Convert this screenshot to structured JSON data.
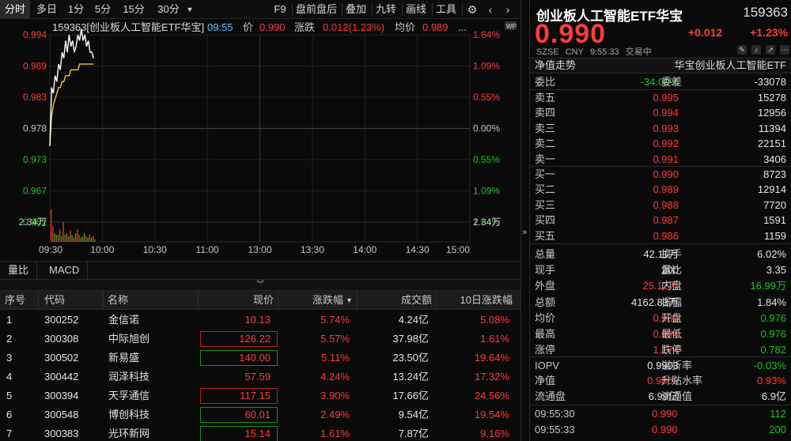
{
  "toolbar": {
    "periods": [
      "分时",
      "多日",
      "1分",
      "5分",
      "15分",
      "30分"
    ],
    "dropdown_icon": "caret-down-icon",
    "tools": [
      "F9",
      "盘前盘后",
      "叠加",
      "九转",
      "画线",
      "工具"
    ],
    "icons": [
      "gear-icon",
      "chevron-left-icon",
      "chevron-right-icon"
    ]
  },
  "chart_header": {
    "code_name": "159363[创业板人工智能ETF华宝]",
    "time": "09:55",
    "price_label": "价",
    "price": "0.990",
    "change_label": "涨跌",
    "change": "0.012(1.23%)",
    "avg_label": "均价",
    "avg": "0.989",
    "more": "...",
    "wp_badge": "WP"
  },
  "chart_data": {
    "type": "line",
    "x_ticks": [
      "09:30",
      "10:00",
      "10:30",
      "11:00",
      "13:00",
      "13:30",
      "14:00",
      "14:30",
      "15:00"
    ],
    "price_ticks": [
      "0.994",
      "0.989",
      "0.983",
      "0.978",
      "0.973",
      "0.967",
      "0.962"
    ],
    "pct_ticks": [
      "1.64%",
      "1.09%",
      "0.55%",
      "0.00%",
      "0.55%",
      "1.09%",
      "1.64%"
    ],
    "prev_close": 0.978,
    "ylim": [
      0.962,
      0.994
    ],
    "volume_label": "2.34万",
    "series": [
      {
        "x": [
          0,
          1,
          2,
          3,
          4,
          5,
          6,
          7,
          8,
          9,
          10,
          11,
          12,
          13,
          14,
          15,
          16,
          17,
          18,
          19,
          20,
          21,
          22,
          23,
          24,
          25
        ],
        "values": [
          0.975,
          0.985,
          0.984,
          0.987,
          0.986,
          0.989,
          0.988,
          0.991,
          0.99,
          0.993,
          0.991,
          0.994,
          0.992,
          0.993,
          0.991,
          0.992,
          0.994,
          0.993,
          0.995,
          0.993,
          0.994,
          0.992,
          0.993,
          0.991,
          0.991,
          0.99
        ]
      },
      {
        "x": [
          0,
          1,
          2,
          3,
          4,
          5,
          6,
          7,
          8,
          9,
          10,
          11,
          12,
          13,
          14,
          15,
          16,
          17,
          18,
          19,
          20,
          21,
          22,
          23,
          24,
          25
        ],
        "values": [
          0.975,
          0.98,
          0.982,
          0.983,
          0.984,
          0.985,
          0.985,
          0.986,
          0.986,
          0.987,
          0.987,
          0.987,
          0.988,
          0.988,
          0.988,
          0.988,
          0.988,
          0.989,
          0.989,
          0.989,
          0.989,
          0.989,
          0.989,
          0.989,
          0.989,
          0.989
        ]
      }
    ],
    "volumes": [
      2.3,
      1.1,
      0.6,
      0.5,
      0.5,
      0.9,
      0.4,
      1.4,
      0.5,
      0.6,
      0.4,
      0.8,
      0.5,
      0.3,
      0.6,
      0.9,
      0.5,
      0.3,
      0.4,
      0.6,
      0.4,
      0.3,
      0.5,
      0.3,
      0.4,
      0.2
    ],
    "volume_colors": [
      "red",
      "red",
      "green",
      "red",
      "green",
      "red",
      "green",
      "red",
      "green",
      "red",
      "green",
      "red",
      "green",
      "red",
      "green",
      "red",
      "red",
      "green",
      "red",
      "green",
      "red",
      "green",
      "red",
      "green",
      "red",
      "green"
    ],
    "volume_max": 2.34,
    "total_minutes": 240,
    "colors": {
      "price_line": "#ffffff",
      "avg_line": "#e8c547",
      "grid": "#262626",
      "up": "#ff3b3b",
      "down": "#19c819"
    }
  },
  "subtabs": [
    "量比",
    "MACD"
  ],
  "collapse_icon": "double-chevron-down-icon",
  "table": {
    "headers": [
      "序号",
      "代码",
      "名称",
      "现价",
      "涨跌幅",
      "成交额",
      "10日涨跌幅"
    ],
    "sort_icon": "caret-down-icon",
    "rows": [
      {
        "no": "1",
        "code": "300252",
        "name": "金信诺",
        "price": "10.13",
        "pct": "5.74%",
        "amount": "4.24亿",
        "pct10": "5.08%",
        "box": ""
      },
      {
        "no": "2",
        "code": "300308",
        "name": "中际旭创",
        "price": "126.22",
        "pct": "5.57%",
        "amount": "37.98亿",
        "pct10": "1.61%",
        "box": "red"
      },
      {
        "no": "3",
        "code": "300502",
        "name": "新易盛",
        "price": "140.00",
        "pct": "5.11%",
        "amount": "23.50亿",
        "pct10": "19.64%",
        "box": "green"
      },
      {
        "no": "4",
        "code": "300442",
        "name": "润泽科技",
        "price": "57.59",
        "pct": "4.24%",
        "amount": "13.24亿",
        "pct10": "17.32%",
        "box": ""
      },
      {
        "no": "5",
        "code": "300394",
        "name": "天孚通信",
        "price": "117.15",
        "pct": "3.90%",
        "amount": "17.66亿",
        "pct10": "24.56%",
        "box": "red"
      },
      {
        "no": "6",
        "code": "300548",
        "name": "博创科技",
        "price": "60.01",
        "pct": "2.49%",
        "amount": "9.54亿",
        "pct10": "19.54%",
        "box": "green"
      },
      {
        "no": "7",
        "code": "300383",
        "name": "光环新网",
        "price": "15.14",
        "pct": "1.61%",
        "amount": "7.87亿",
        "pct10": "9.16%",
        "box": "green"
      }
    ]
  },
  "divider_icon": "double-chevron-right-icon",
  "quote": {
    "name": "创业板人工智能ETF华宝",
    "code": "159363",
    "price": "0.990",
    "change": "+0.012",
    "pct": "+1.23%",
    "exchange": "SZSE",
    "currency": "CNY",
    "time": "9:55:33",
    "status": "交易中",
    "icons": [
      "edit-icon",
      "bell-icon",
      "share-icon",
      "more-icon"
    ],
    "nav_label": "净值走势",
    "nav_name": "华宝创业板人工智能ETF",
    "weibi": {
      "label": "委比",
      "value": "-34.00%",
      "label2": "委差",
      "value2": "-33078"
    },
    "asks": [
      {
        "label": "卖五",
        "price": "0.995",
        "vol": "15278"
      },
      {
        "label": "卖四",
        "price": "0.994",
        "vol": "12956"
      },
      {
        "label": "卖三",
        "price": "0.993",
        "vol": "11394"
      },
      {
        "label": "卖二",
        "price": "0.992",
        "vol": "22151"
      },
      {
        "label": "卖一",
        "price": "0.991",
        "vol": "3406"
      }
    ],
    "bids": [
      {
        "label": "买一",
        "price": "0.990",
        "vol": "8723"
      },
      {
        "label": "买二",
        "price": "0.989",
        "vol": "12914"
      },
      {
        "label": "买三",
        "price": "0.988",
        "vol": "7720"
      },
      {
        "label": "买四",
        "price": "0.987",
        "vol": "1591"
      },
      {
        "label": "买五",
        "price": "0.986",
        "vol": "1159"
      }
    ],
    "stats": [
      {
        "l1": "总量",
        "v1": "42.11万",
        "c1": "white",
        "l2": "换手",
        "v2": "6.02%",
        "c2": "white"
      },
      {
        "l1": "现手",
        "v1": "200",
        "c1": "white",
        "l2": "量比",
        "v2": "3.35",
        "c2": "white"
      },
      {
        "l1": "外盘",
        "v1": "25.12万",
        "c1": "red",
        "l2": "内盘",
        "v2": "16.99万",
        "c2": "green"
      },
      {
        "l1": "总额",
        "v1": "4162.83万",
        "c1": "white",
        "l2": "振幅",
        "v2": "1.84%",
        "c2": "white"
      },
      {
        "l1": "均价",
        "v1": "0.989",
        "c1": "red",
        "l2": "开盘",
        "v2": "0.976",
        "c2": "green"
      },
      {
        "l1": "最高",
        "v1": "0.994",
        "c1": "red",
        "l2": "最低",
        "v2": "0.976",
        "c2": "green"
      },
      {
        "l1": "涨停",
        "v1": "1.174",
        "c1": "red",
        "l2": "跌停",
        "v2": "0.782",
        "c2": "green"
      }
    ],
    "fund": [
      {
        "l1": "IOPV",
        "v1": "0.9903",
        "c1": "white",
        "l2": "溢折率",
        "v2": "-0.03%",
        "c2": "green"
      },
      {
        "l1": "净值",
        "v1": "0.9809",
        "c1": "red",
        "l2": "升贴水率",
        "v2": "0.93%",
        "c2": "red"
      },
      {
        "l1": "流通盘",
        "v1": "6.99亿",
        "c1": "white",
        "l2": "流通值",
        "v2": "6.9亿",
        "c2": "white"
      }
    ],
    "ticks": [
      {
        "time": "09:55:30",
        "price": "0.990",
        "vol": "112"
      },
      {
        "time": "09:55:33",
        "price": "0.990",
        "vol": "200"
      }
    ]
  }
}
